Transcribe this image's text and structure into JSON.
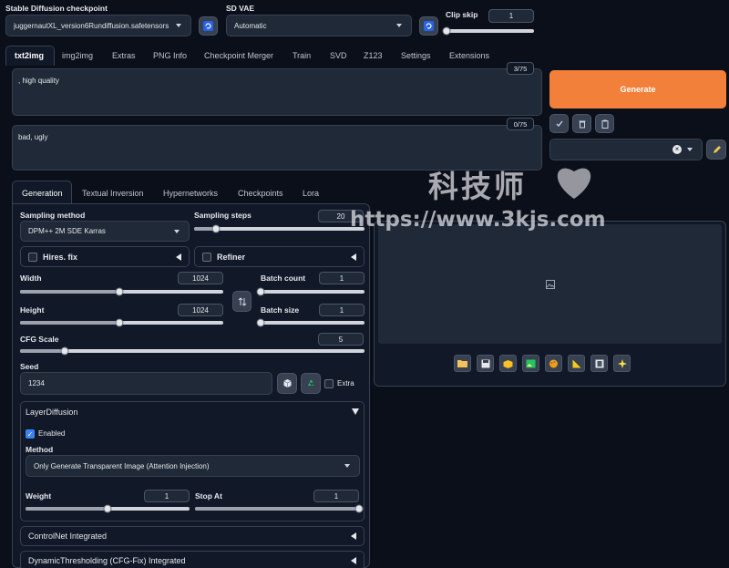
{
  "header": {
    "checkpoint_label": "Stable Diffusion checkpoint",
    "checkpoint_value": "juggernautXL_version6Rundiffusion.safetensors",
    "vae_label": "SD VAE",
    "vae_value": "Automatic",
    "clip_label": "Clip skip",
    "clip_value": "1",
    "clip_fraction": 0.0
  },
  "tabs": [
    "txt2img",
    "img2img",
    "Extras",
    "PNG Info",
    "Checkpoint Merger",
    "Train",
    "SVD",
    "Z123",
    "Settings",
    "Extensions"
  ],
  "prompt": {
    "value": ", high quality",
    "counter": "3/75"
  },
  "negative": {
    "value": "bad, ugly",
    "counter": "0/75"
  },
  "generate_label": "Generate",
  "subtabs": [
    "Generation",
    "Textual Inversion",
    "Hypernetworks",
    "Checkpoints",
    "Lora"
  ],
  "sampling": {
    "method_label": "Sampling method",
    "method_value": "DPM++ 2M SDE Karras",
    "steps_label": "Sampling steps",
    "steps_value": "20",
    "steps_fraction": 0.13
  },
  "hires_label": "Hires. fix",
  "refiner_label": "Refiner",
  "width": {
    "label": "Width",
    "value": "1024",
    "fraction": 0.49
  },
  "height": {
    "label": "Height",
    "value": "1024",
    "fraction": 0.49
  },
  "batch_count": {
    "label": "Batch count",
    "value": "1",
    "fraction": 0.0
  },
  "batch_size": {
    "label": "Batch size",
    "value": "1",
    "fraction": 0.0
  },
  "cfg": {
    "label": "CFG Scale",
    "value": "5",
    "fraction": 0.13
  },
  "seed": {
    "label": "Seed",
    "value": "1234",
    "extra_label": "Extra"
  },
  "layerdiffusion": {
    "title": "LayerDiffusion",
    "enabled_label": "Enabled",
    "method_label": "Method",
    "method_value": "Only Generate Transparent Image (Attention Injection)",
    "weight_label": "Weight",
    "weight_value": "1",
    "weight_fraction": 0.5,
    "stop_label": "Stop At",
    "stop_value": "1",
    "stop_fraction": 1.0
  },
  "controlnet_label": "ControlNet Integrated",
  "dynthresh_label": "DynamicThresholding (CFG-Fix) Integrated",
  "watermark": {
    "text": "科技师",
    "url": "https://www.3kjs.com"
  },
  "colors": {
    "generate": "#f2803a",
    "accent": "#3b82f6"
  }
}
